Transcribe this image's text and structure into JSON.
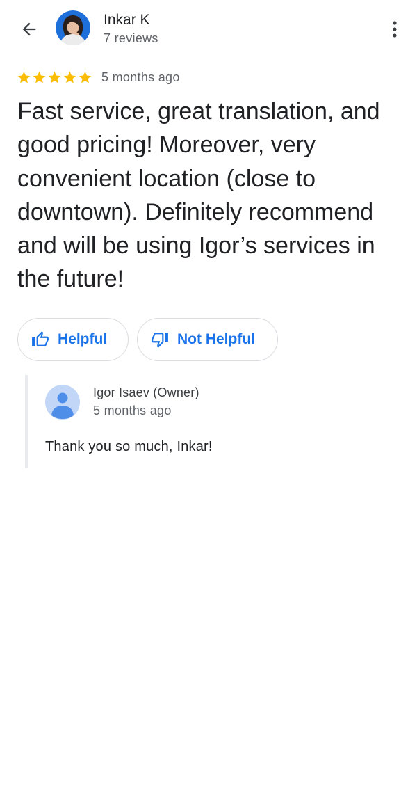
{
  "header": {
    "reviewer_name": "Inkar K",
    "reviewer_reviews": "7 reviews",
    "back_icon": "arrow-back-icon",
    "more_icon": "more-vert-icon"
  },
  "review": {
    "rating": 5,
    "max_rating": 5,
    "date": "5 months ago",
    "text": "Fast service, great translation, and good pricing! Moreover, very convenient location (close to downtown). Definitely recommend and will be using Igor’s services in the future!",
    "star_color": "#fbbc04"
  },
  "feedback": {
    "helpful_label": "Helpful",
    "not_helpful_label": "Not Helpful",
    "accent_color": "#1a73e8"
  },
  "owner_reply": {
    "name": "Igor Isaev (Owner)",
    "date": "5 months ago",
    "text": "Thank you so much, Inkar!"
  }
}
